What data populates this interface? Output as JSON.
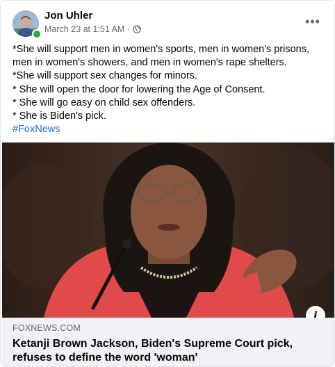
{
  "post": {
    "author": "Jon Uhler",
    "timestamp": "March 23 at 1:51 AM",
    "separator": "·",
    "privacy_icon": "globe-icon",
    "more_label": "•••",
    "lines": [
      "*She will support men in women's sports, men in women's prisons, men in women's showers, and men in women's rape shelters.",
      "*She will support sex changes for minors.",
      "* She will open the door for lowering the Age of Consent.",
      "* She will go easy on child sex offenders.",
      "* She is Biden's pick."
    ],
    "hashtag": "#FoxNews"
  },
  "link": {
    "domain": "FOXNEWS.COM",
    "headline": "Ketanji Brown Jackson, Biden's Supreme Court pick, refuses to define the word 'woman'",
    "info_label": "i"
  },
  "colors": {
    "link_blue": "#216fdb",
    "secondary_text": "#65676b",
    "online_green": "#31a24c",
    "card_bg": "#f0f2f5",
    "jacket_red": "#e04a4a"
  }
}
